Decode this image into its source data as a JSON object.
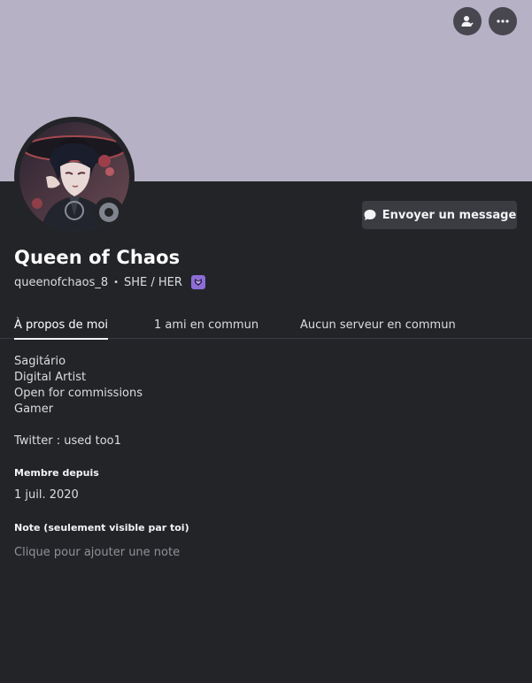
{
  "profile": {
    "display_name": "Queen of Chaos",
    "username": "queenofchaos_8",
    "separator": "•",
    "pronouns": "SHE / HER",
    "status": "offline",
    "banner_color": "#b6b1c5"
  },
  "actions": {
    "send_message_label": "Envoyer un message"
  },
  "tabs": [
    {
      "label": "À propos de moi",
      "active": true
    },
    {
      "label": "1 ami en commun",
      "active": false
    },
    {
      "label": "Aucun serveur en commun",
      "active": false
    }
  ],
  "about": {
    "bio_lines": [
      "Sagitário",
      "Digital Artist",
      "Open for commissions",
      "Gamer",
      "",
      "Twitter : used too1"
    ],
    "member_since_title": "Membre depuis",
    "member_since_value": "1 juil. 2020",
    "note_title": "Note (seulement visible par toi)",
    "note_placeholder": "Clique pour ajouter une note"
  },
  "icons": {
    "friend_action": "add-friend-icon",
    "more": "more-icon",
    "message": "message-bubble-icon",
    "badge": "nitro-badge-icon"
  }
}
